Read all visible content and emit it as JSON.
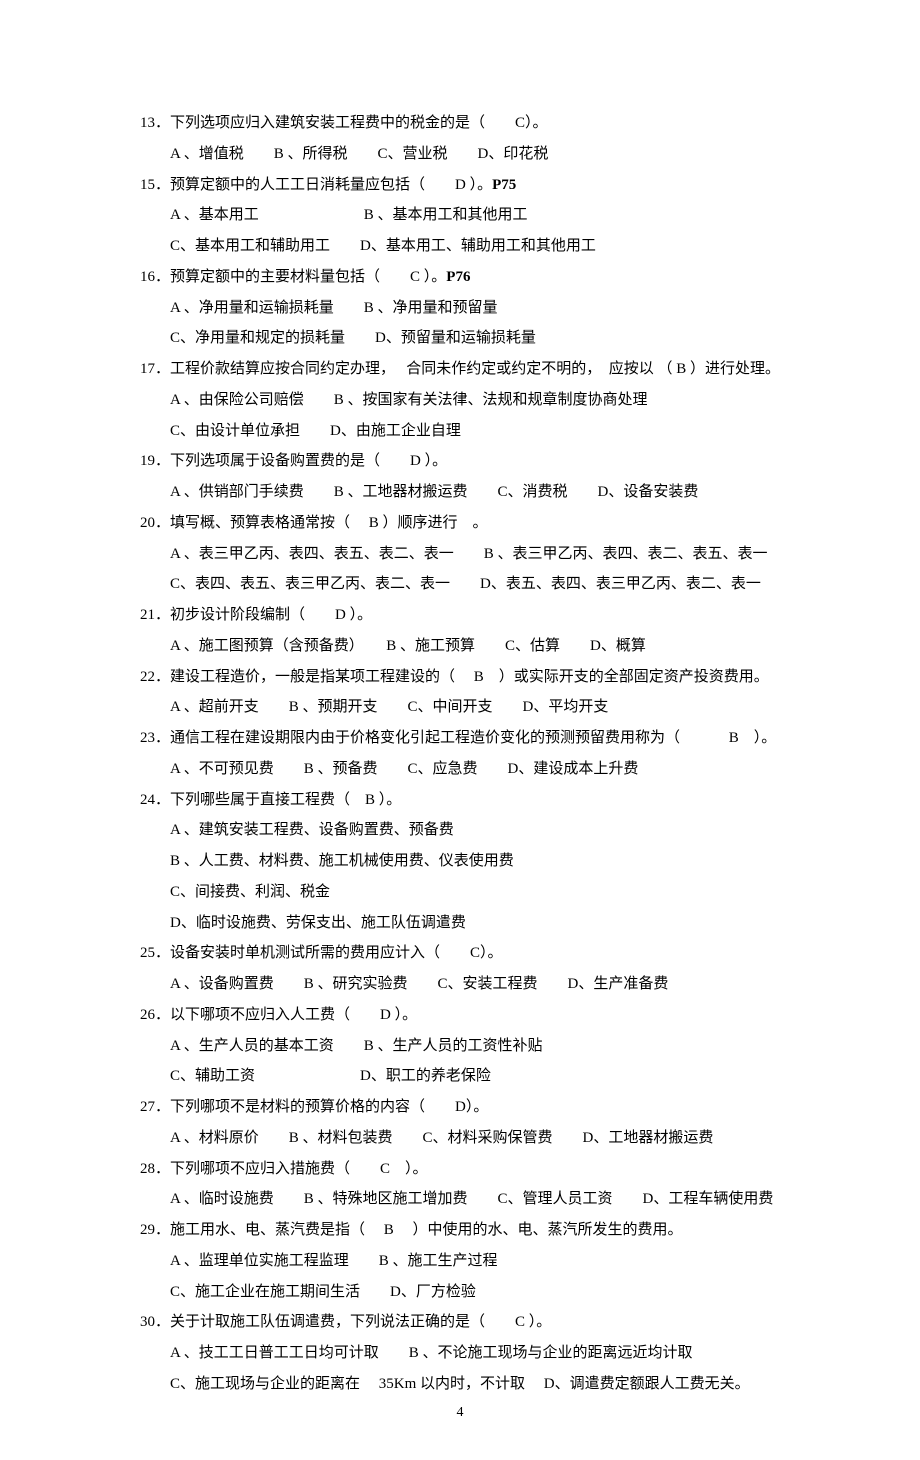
{
  "pageNumber": "4",
  "questions": [
    {
      "num": "13",
      "stem_a": "．下列选项应归入建筑安装工程费中的税金的是（",
      "stem_ans": "C",
      "stem_b": "）。",
      "opts": [
        "A 、增值税　　B 、所得税　　C、营业税　　D、印花税"
      ]
    },
    {
      "num": "15",
      "stem_a": "．预算定额中的人工工日消耗量应包括（",
      "stem_ans": "D",
      "stem_b": "  ）。",
      "stem_extra": "P75",
      "opts": [
        "A 、基本用工　　　　　　　B 、基本用工和其他用工",
        "C、基本用工和辅助用工　　D、基本用工、辅助用工和其他用工"
      ]
    },
    {
      "num": "16",
      "stem_a": "．预算定额中的主要材料量包括（",
      "stem_ans": "C",
      "stem_b": "  ）。",
      "stem_extra": "P76",
      "opts": [
        "A 、净用量和运输损耗量　　B 、净用量和预留量",
        "C、净用量和规定的损耗量　　D、预留量和运输损耗量"
      ]
    },
    {
      "num": "17",
      "stem_a": "．工程价款结算应按合同约定办理，　 合同未作约定或约定不明的，　应按以 （  B  ）进行处理。",
      "opts": [
        "A 、由保险公司赔偿　　B 、按国家有关法律、法规和规章制度协商处理",
        "C、由设计单位承担　　D、由施工企业自理"
      ]
    },
    {
      "num": "19",
      "stem_a": "．下列选项属于设备购置费的是（",
      "stem_ans": "D",
      "stem_b": "  ）。",
      "opts": [
        "A 、供销部门手续费　　B 、工地器材搬运费　　C、消费税　　D、设备安装费"
      ]
    },
    {
      "num": "20",
      "stem_a": "．填写概、预算表格通常按（　  B  ）顺序进行　。",
      "opts": [
        "A 、表三甲乙丙、表四、表五、表二、表一　　B 、表三甲乙丙、表四、表二、表五、表一",
        "C、表四、表五、表三甲乙丙、表二、表一　　D、表五、表四、表三甲乙丙、表二、表一"
      ]
    },
    {
      "num": "21",
      "stem_a": "．初步设计阶段编制（",
      "stem_ans": "D",
      "stem_b": "  ）。",
      "opts": [
        "A 、施工图预算（含预备费）　　B 、施工预算　　C、估算　　D、概算"
      ]
    },
    {
      "num": "22",
      "stem_a": "．建设工程造价，一般是指某项工程建设的（　  B　）或实际开支的全部固定资产投资费用。",
      "opts": [
        "A 、超前开支　　B 、预期开支　　C、中间开支　　D、平均开支"
      ]
    },
    {
      "num": "23",
      "stem_a": "．通信工程在建设期限内由于价格变化引起工程造价变化的预测预留费用称为（　　　 B　）。",
      "opts": [
        "A 、不可预见费　　B 、预备费　　C、应急费　　D、建设成本上升费"
      ]
    },
    {
      "num": "24",
      "stem_a": "．下列哪些属于直接工程费（　B ）。",
      "opts": [
        "A 、建筑安装工程费、设备购置费、预备费",
        "B 、人工费、材料费、施工机械使用费、仪表使用费",
        "C、间接费、利润、税金",
        "D、临时设施费、劳保支出、施工队伍调遣费"
      ]
    },
    {
      "num": "25",
      "stem_a": "．设备安装时单机测试所需的费用应计入（",
      "stem_ans": "C",
      "stem_b": "）。",
      "opts": [
        "A 、设备购置费　　B 、研究实验费　　C、安装工程费　　D、生产准备费"
      ]
    },
    {
      "num": "26",
      "stem_a": "．以下哪项不应归入人工费（",
      "stem_ans": "D",
      "stem_b": "  ）。",
      "opts": [
        "A 、生产人员的基本工资　　B 、生产人员的工资性补贴",
        "C、辅助工资　　　　　　　D、职工的养老保险"
      ]
    },
    {
      "num": "27",
      "stem_a": "．下列哪项不是材料的预算价格的内容（",
      "stem_ans": "D",
      "stem_b": "）。",
      "opts": [
        "A 、材料原价　　B 、材料包装费　　C、材料采购保管费　　D、工地器材搬运费"
      ]
    },
    {
      "num": "28",
      "stem_a": "．下列哪项不应归入措施费（",
      "stem_ans": "C",
      "stem_b": "　）。",
      "opts": [
        "A 、临时设施费　　B 、特殊地区施工增加费　　C、管理人员工资　　D、工程车辆使用费"
      ]
    },
    {
      "num": "29",
      "stem_a": "．施工用水、电、蒸汽费是指（　  B　 ）中使用的水、电、蒸汽所发生的费用。",
      "opts": [
        "A 、监理单位实施工程监理　　B 、施工生产过程",
        "C、施工企业在施工期间生活　　D、厂方检验"
      ]
    },
    {
      "num": "30",
      "stem_a": "．关于计取施工队伍调遣费，下列说法正确的是（",
      "stem_ans": "C",
      "stem_b": " ）。",
      "opts": [
        "A 、技工工日普工工日均可计取　　B 、不论施工现场与企业的距离远近均计取",
        "C、施工现场与企业的距离在　 35Km 以内时，不计取　 D、调遣费定额跟人工费无关。"
      ]
    }
  ]
}
